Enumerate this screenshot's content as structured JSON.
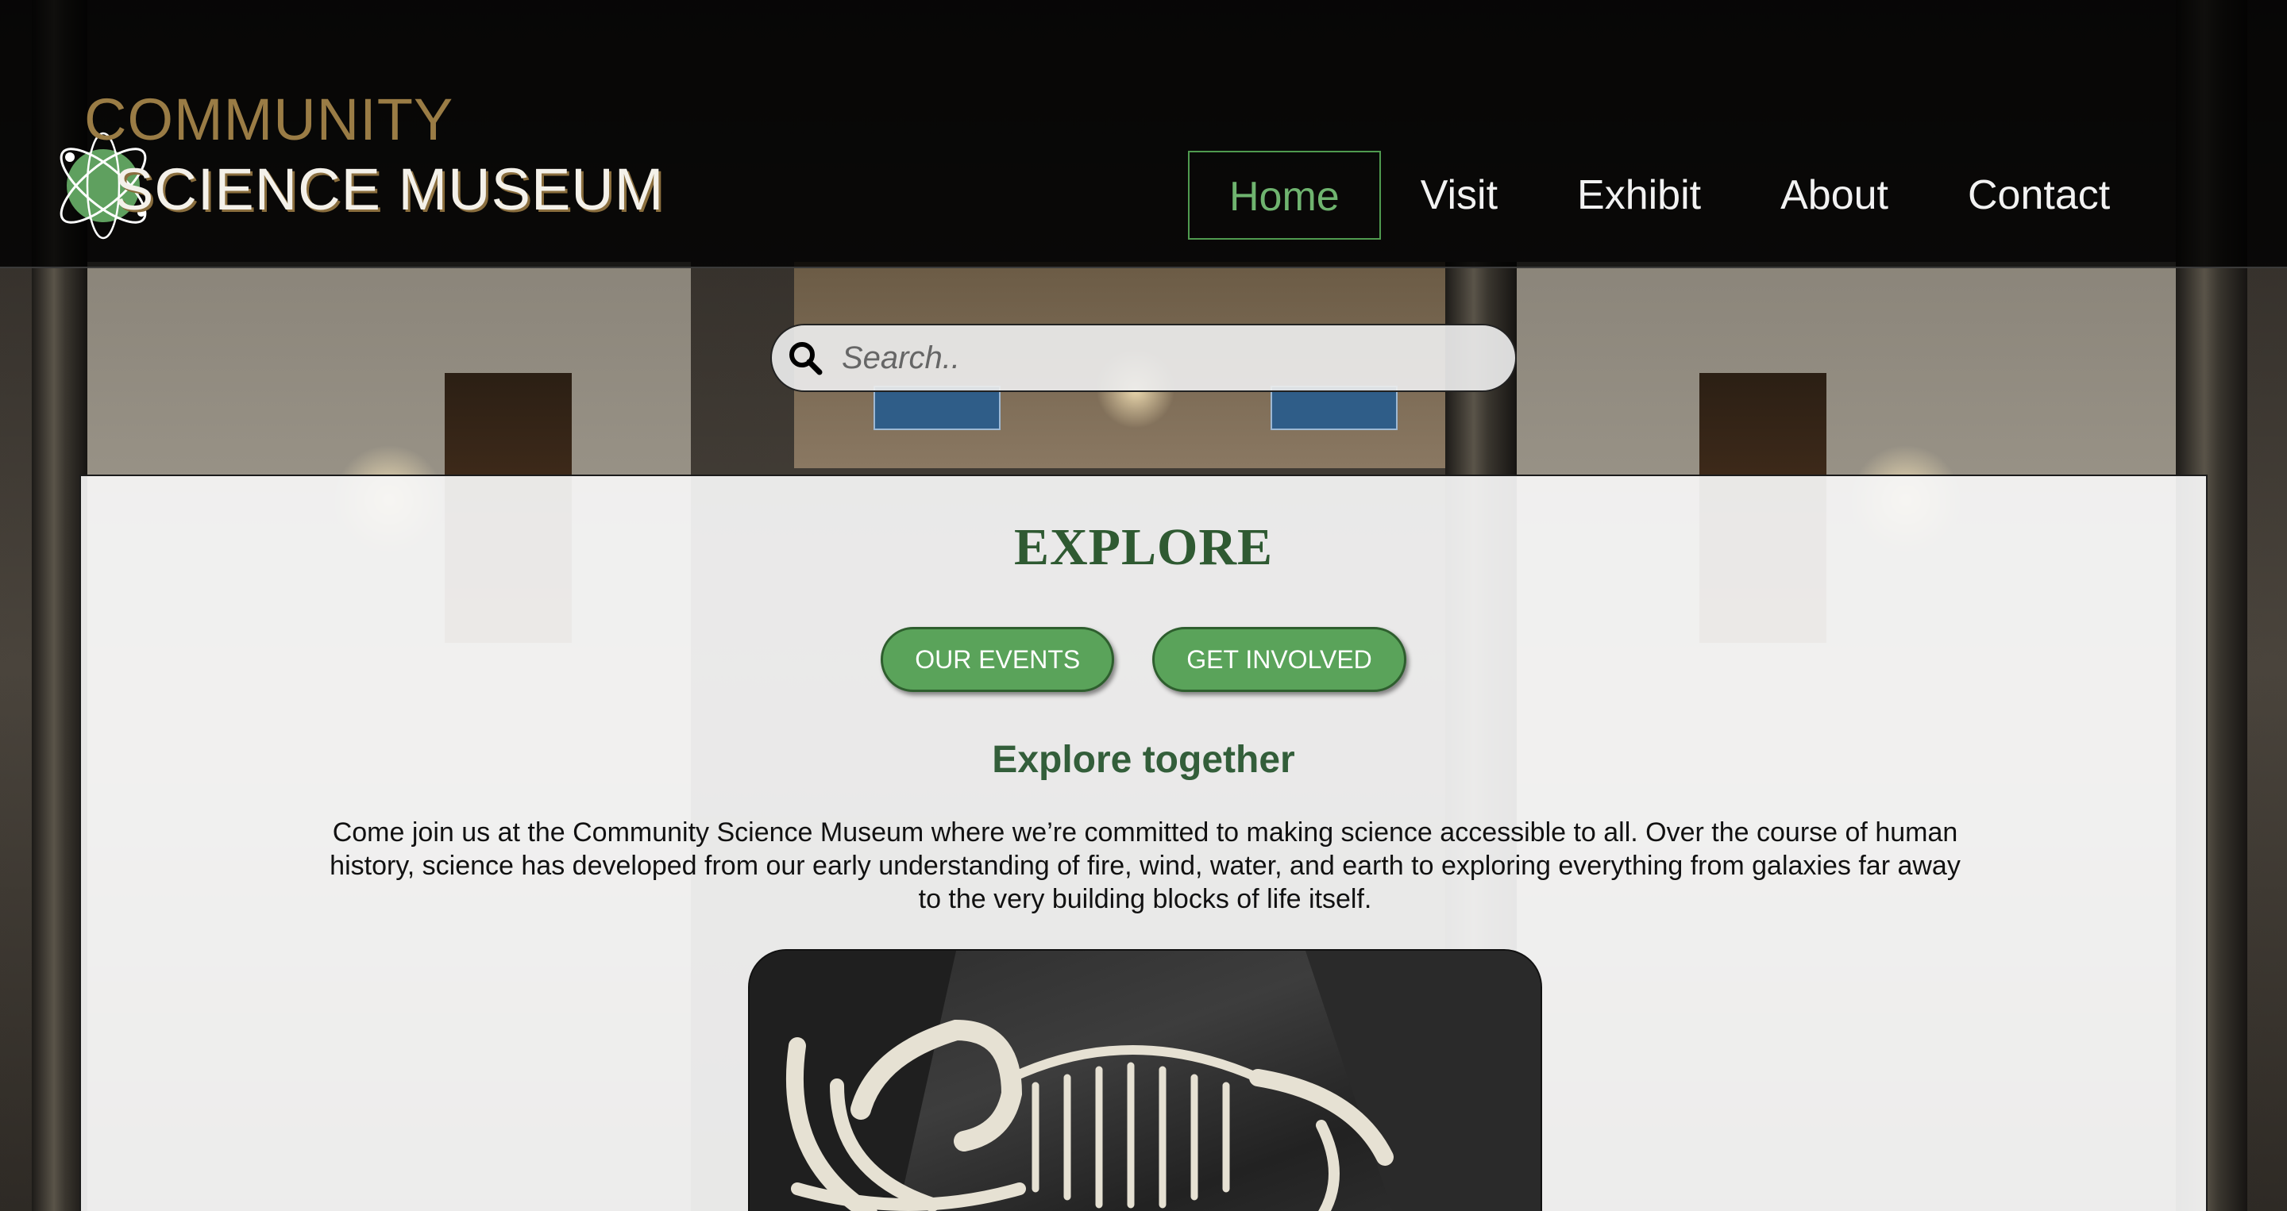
{
  "header": {
    "logo_line1": "COMMUNITY",
    "logo_line2": "SCIENCE MUSEUM",
    "nav": [
      {
        "label": "Home",
        "active": true
      },
      {
        "label": "Visit",
        "active": false
      },
      {
        "label": "Exhibit",
        "active": false
      },
      {
        "label": "About",
        "active": false
      },
      {
        "label": "Contact",
        "active": false
      }
    ]
  },
  "search": {
    "placeholder": "Search..",
    "value": "",
    "icon": "search-icon"
  },
  "main": {
    "title": "EXPLORE",
    "buttons": [
      {
        "label": "OUR EVENTS"
      },
      {
        "label": "GET INVOLVED"
      }
    ],
    "subtitle": "Explore together",
    "paragraph": "Come join us at the Community Science Museum where we’re committed to making science accessible to all. Over the course of human history, science has developed from our early understanding of fire, wind, water, and earth to exploring everything from galaxies far away to the very building blocks of life itself."
  },
  "colors": {
    "accent_green": "#5aa35a",
    "title_green": "#2f5a32",
    "logo_gold": "#9a7c45",
    "header_bg": "#0a0a0a"
  }
}
